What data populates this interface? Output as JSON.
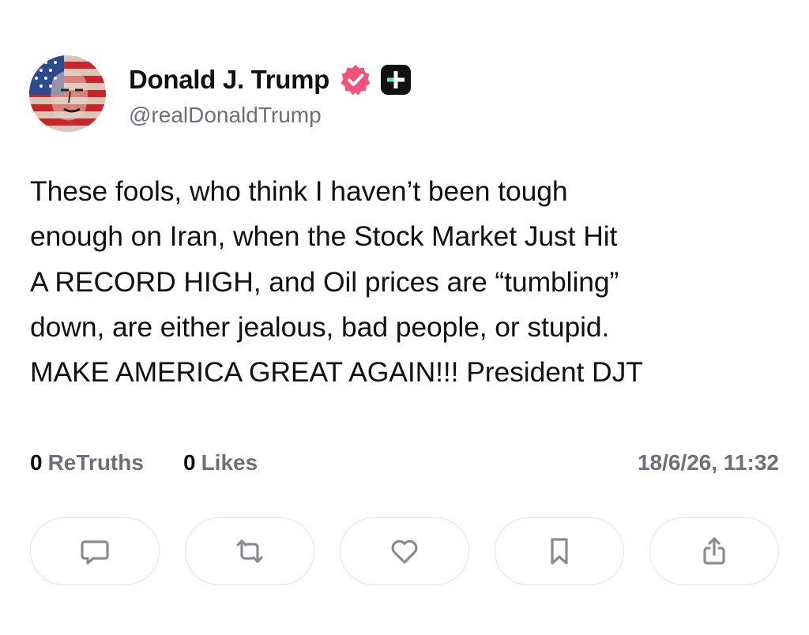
{
  "author": {
    "display_name": "Donald J. Trump",
    "handle": "@realDonaldTrump",
    "avatar_icon": "flag-face-avatar",
    "verified_icon": "verified-badge-icon",
    "verified_color": "#f0527a",
    "plus_icon": "truth-plus-icon"
  },
  "post": {
    "text": "These fools, who think I haven’t been tough\nenough on Iran, when the Stock Market Just Hit\nA RECORD HIGH, and Oil prices are “tumbling”\ndown, are either jealous, bad people, or stupid.\nMAKE AMERICA GREAT AGAIN!!! President DJT"
  },
  "stats": {
    "retruths_count": "0",
    "retruths_label": "ReTruths",
    "likes_count": "0",
    "likes_label": "Likes",
    "timestamp": "18/6/26, 11:32"
  },
  "actions": [
    {
      "icon": "comment-icon"
    },
    {
      "icon": "retruth-icon"
    },
    {
      "icon": "heart-icon"
    },
    {
      "icon": "bookmark-icon"
    },
    {
      "icon": "share-icon"
    }
  ],
  "colors": {
    "text": "#111111",
    "muted": "#6f6f7a",
    "border": "#e2e2e7",
    "accent": "#f0527a"
  }
}
